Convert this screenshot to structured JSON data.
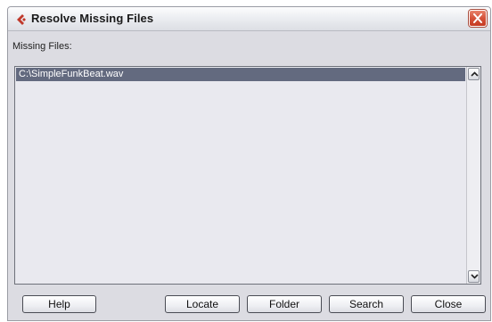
{
  "window": {
    "title": "Resolve Missing Files",
    "icon": "cubase-icon",
    "close_icon": "close-icon"
  },
  "missing_files": {
    "label": "Missing Files:",
    "items": [
      "C:\\SimpleFunkBeat.wav"
    ]
  },
  "buttons": {
    "help": "Help",
    "locate": "Locate",
    "folder": "Folder",
    "search": "Search",
    "close": "Close"
  },
  "colors": {
    "selection": "#636a7f",
    "close_button": "#d5533a",
    "app_icon": "#c0392b"
  }
}
